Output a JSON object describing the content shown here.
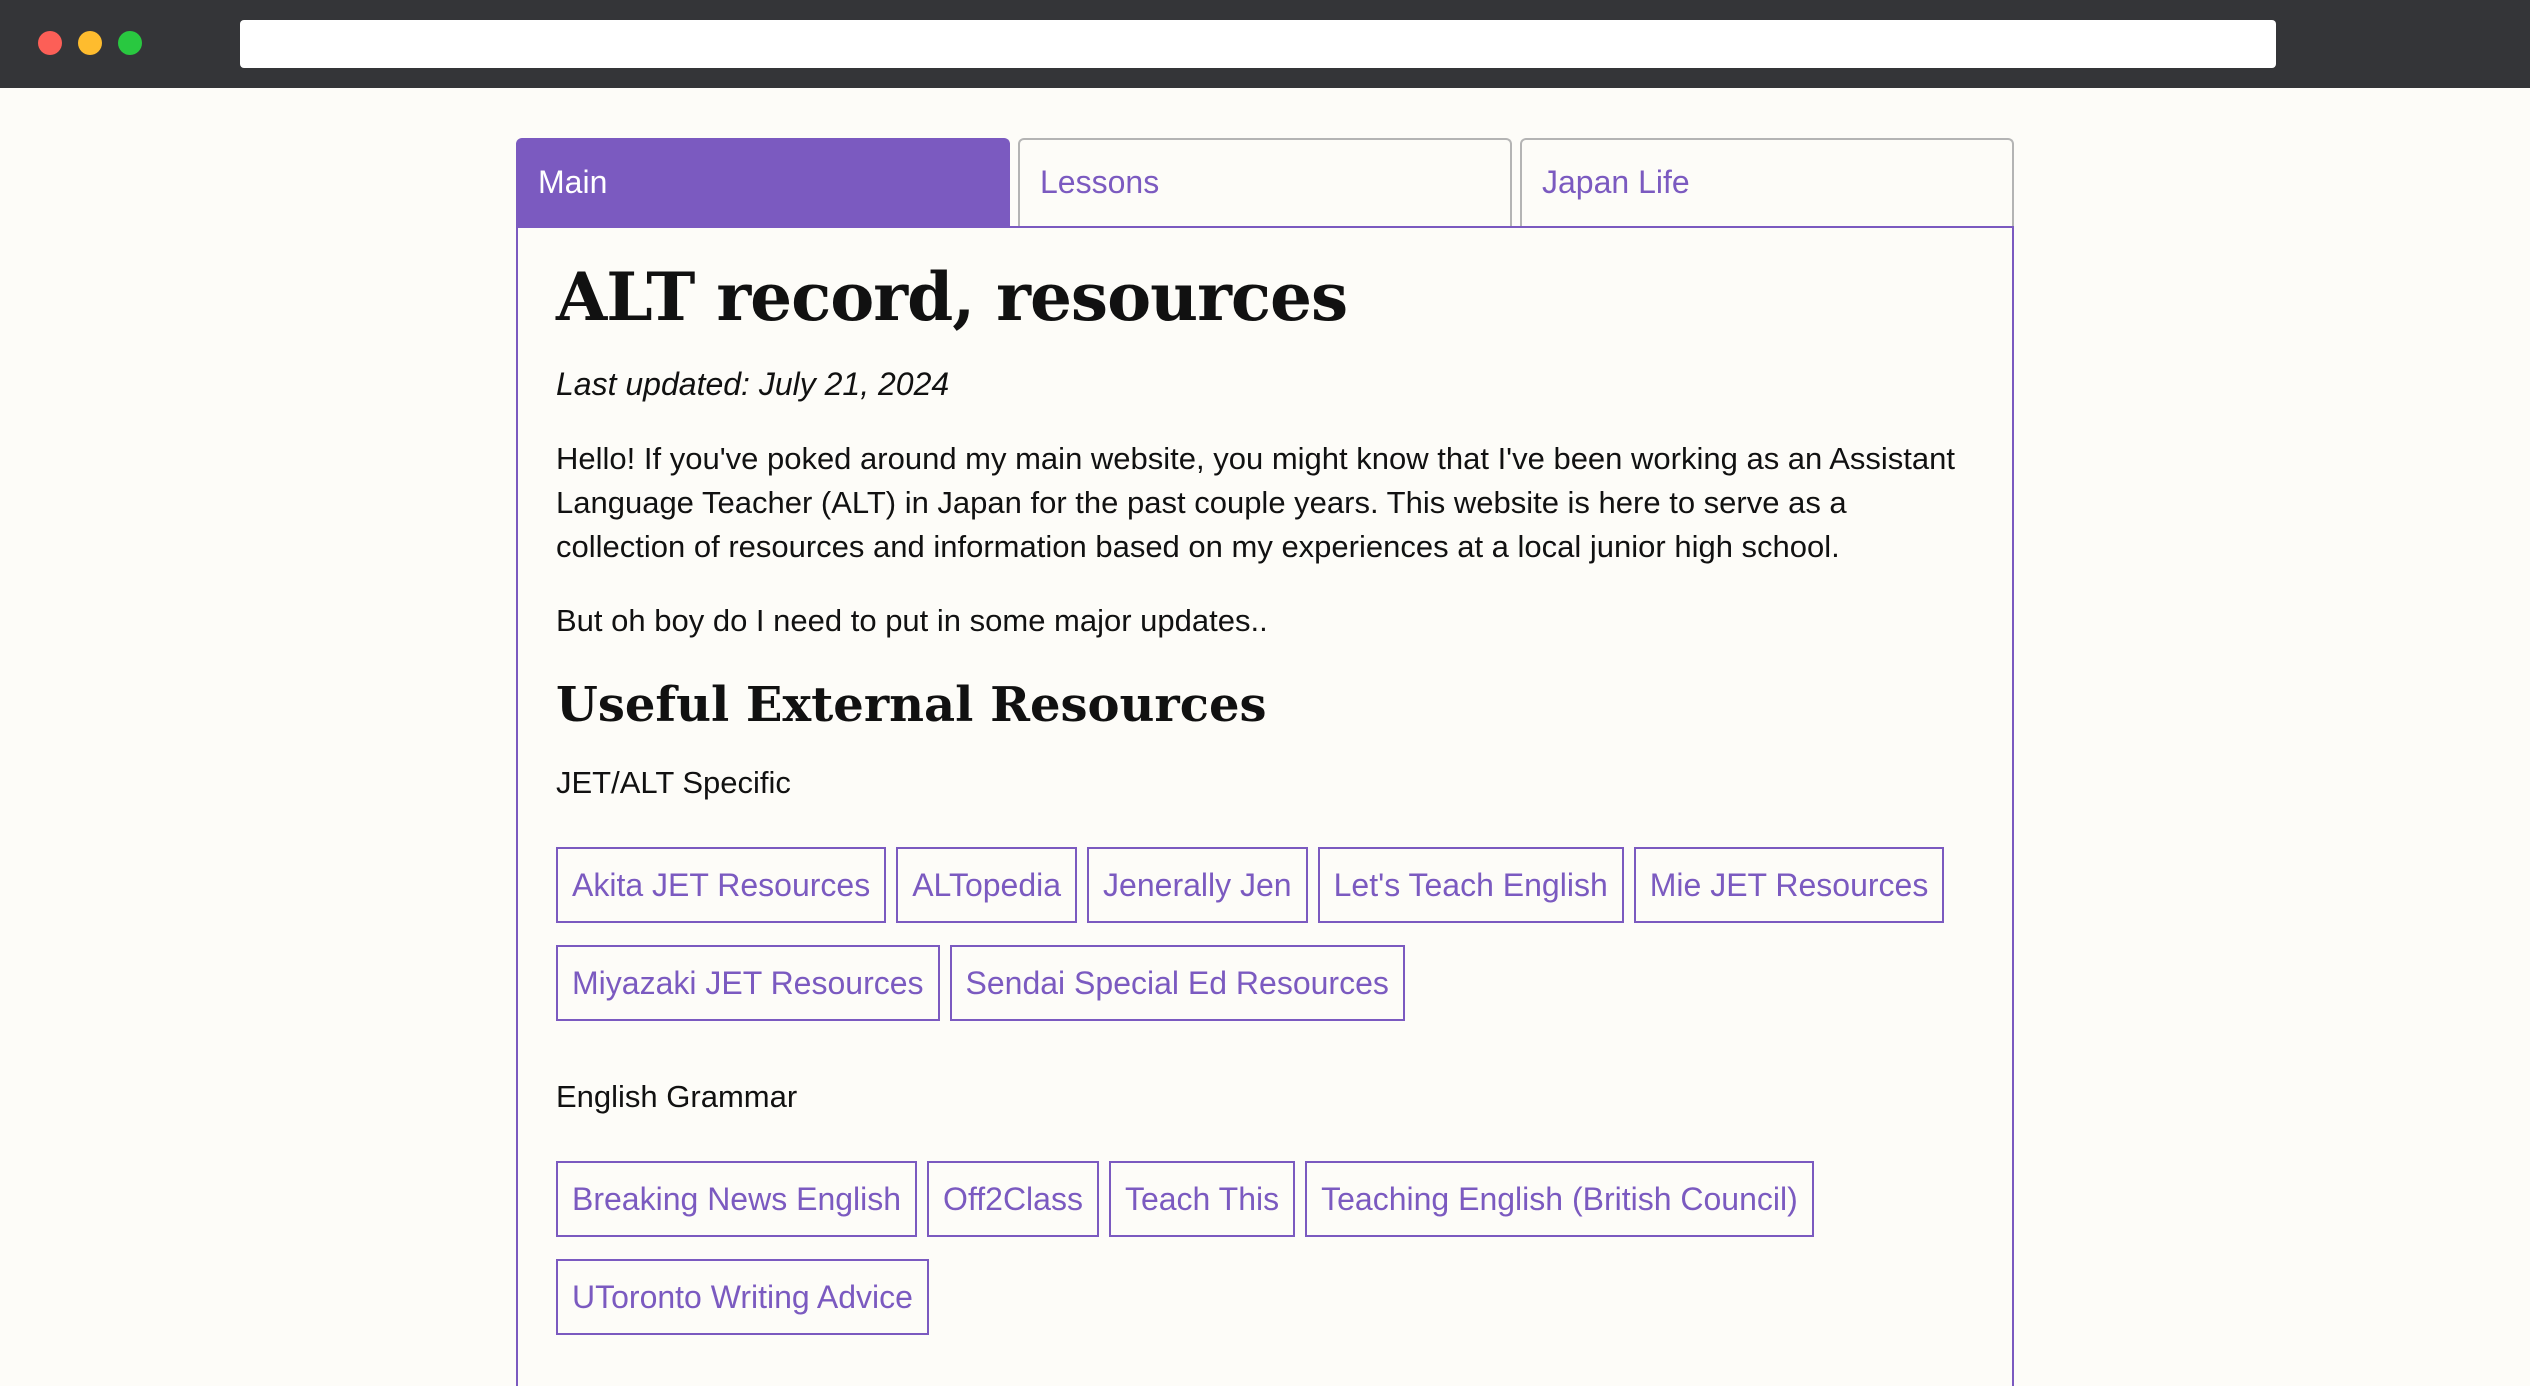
{
  "tabs": [
    {
      "label": "Main"
    },
    {
      "label": "Lessons"
    },
    {
      "label": "Japan Life"
    }
  ],
  "main": {
    "title": "ALT record, resources",
    "updated": "Last updated: July 21, 2024",
    "intro": "Hello! If you've poked around my main website, you might know that I've been working as an Assistant Language Teacher (ALT) in Japan for the past couple years. This website is here to serve as a collection of resources and information based on my experiences at a local junior high school.",
    "note": "But oh boy do I need to put in some major updates..",
    "resources_heading": "Useful External Resources",
    "groups": [
      {
        "label": "JET/ALT Specific",
        "links": [
          "Akita JET Resources",
          "ALTopedia",
          "Jenerally Jen",
          "Let's Teach English",
          "Mie JET Resources",
          "Miyazaki JET Resources",
          "Sendai Special Ed Resources"
        ]
      },
      {
        "label": "English Grammar",
        "links": [
          "Breaking News English",
          "Off2Class",
          "Teach This",
          "Teaching English (British Council)",
          "UToronto Writing Advice"
        ]
      }
    ]
  },
  "colors": {
    "accent": "#7b5ac0",
    "chrome": "#343538",
    "background": "#fdfcf8"
  }
}
